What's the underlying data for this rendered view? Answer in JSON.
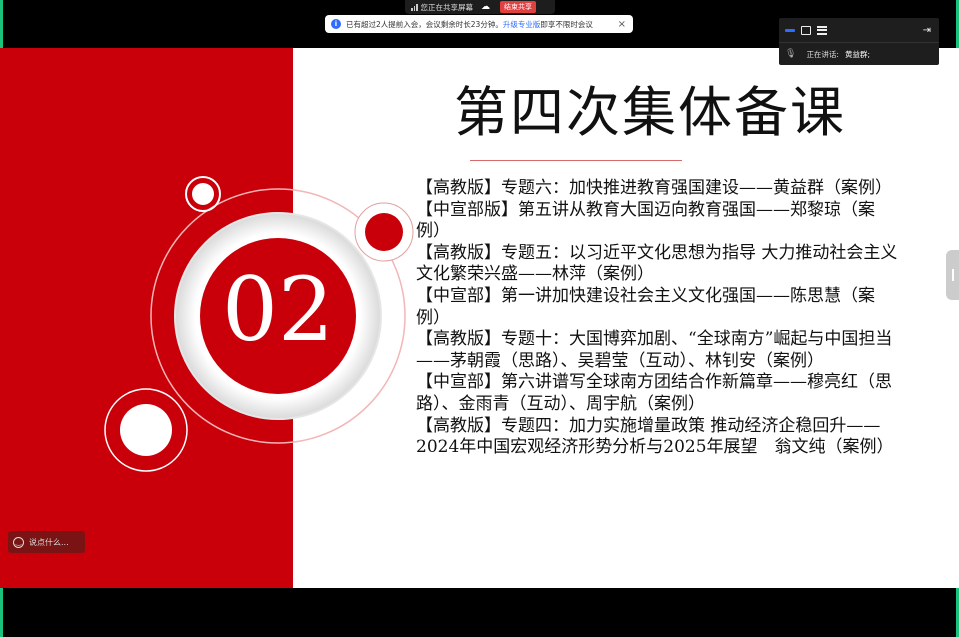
{
  "screen_share": {
    "status_text": "您正在共享屏幕",
    "stop_label": "结束共享"
  },
  "notice": {
    "text": "已有超过2人提前入会，会议剩余时长23分钟。",
    "link_text": "升级专业版",
    "suffix": "即享不限时会议",
    "close_icon": "×"
  },
  "speaker_panel": {
    "label": "正在讲话:",
    "speaker_name": "黄益群;"
  },
  "chat": {
    "placeholder": "说点什么..."
  },
  "slide": {
    "number": "02",
    "title": "第四次集体备课",
    "items": [
      "【高教版】专题六：加快推进教育强国建设——黄益群（案例）",
      "【中宣部版】第五讲从教育大国迈向教育强国——郑黎琼（案例）",
      "【高教版】专题五：以习近平文化思想为指导 大力推动社会主义文化繁荣兴盛——林萍（案例）",
      "【中宣部】第一讲加快建设社会主义文化强国——陈思慧（案例）",
      "【高教版】专题十：大国博弈加剧、“全球南方”崛起与中国担当——茅朝霞（思路）、吴碧莹（互动）、林钊安（案例）",
      "【中宣部】第六讲谱写全球南方团结合作新篇章——穆亮红（思路）、金雨青（互动）、周宇航（案例）",
      "【高教版】专题四：加力实施增量政策 推动经济企稳回升——2024年中国宏观经济形势分析与2025年展望　翁文纯（案例）"
    ]
  },
  "colors": {
    "slide_red": "#c9000a",
    "accent_blue": "#2f6bff",
    "frame_green": "#19c37d"
  }
}
